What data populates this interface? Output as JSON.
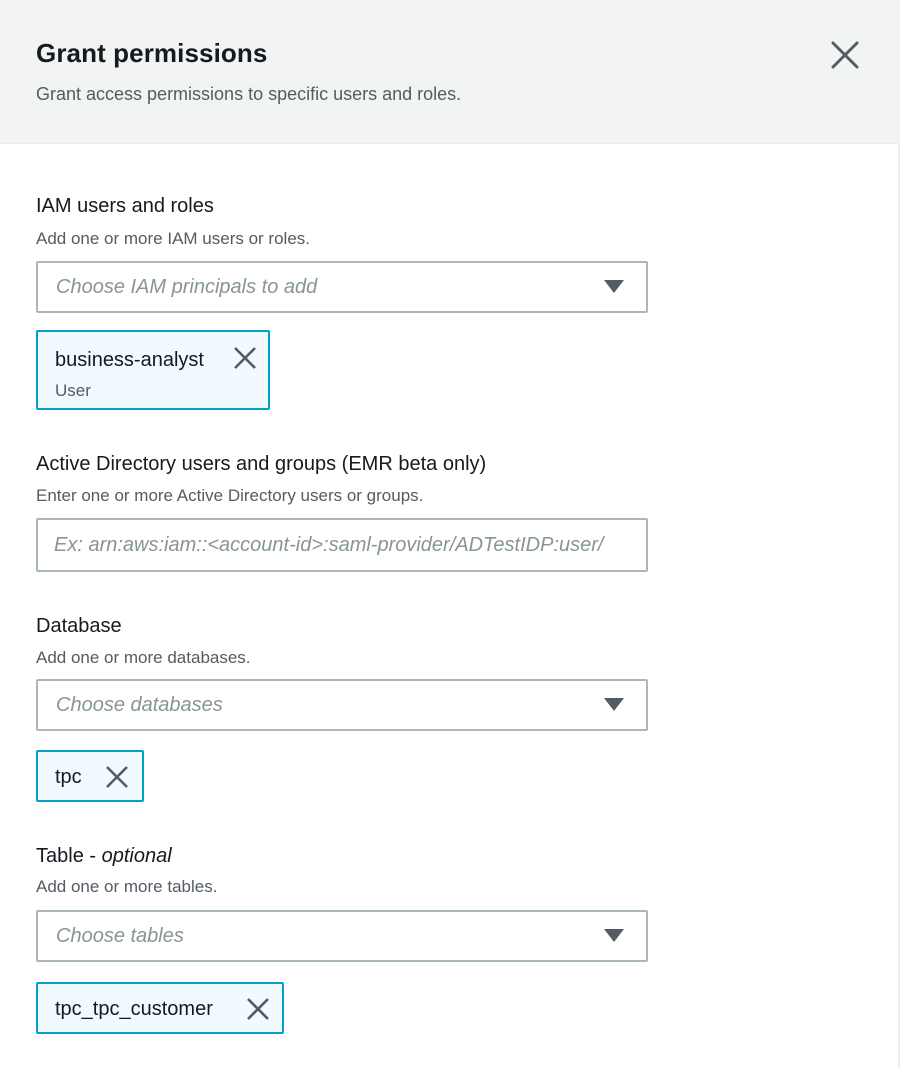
{
  "modal": {
    "title": "Grant permissions",
    "subtitle": "Grant access permissions to specific users and roles.",
    "close_icon": "close-icon"
  },
  "iam": {
    "label": "IAM users and roles",
    "description": "Add one or more IAM users or roles.",
    "placeholder": "Choose IAM principals to add",
    "tokens": [
      {
        "name": "business-analyst",
        "type": "User"
      }
    ]
  },
  "active_directory": {
    "label": "Active Directory users and groups (EMR beta only)",
    "description": "Enter one or more Active Directory users or groups.",
    "placeholder": "Ex: arn:aws:iam::<account-id>:saml-provider/ADTestIDP:user/",
    "value": ""
  },
  "database": {
    "label": "Database",
    "description": "Add one or more databases.",
    "placeholder": "Choose databases",
    "tokens": [
      {
        "name": "tpc"
      }
    ]
  },
  "table": {
    "label": "Table - ",
    "label_optional": "optional",
    "description": "Add one or more tables.",
    "placeholder": "Choose tables",
    "tokens": [
      {
        "name": "tpc_tpc_customer"
      }
    ]
  },
  "colors": {
    "header_bg": "#f2f3f3",
    "token_border": "#00a1c9",
    "token_bg": "#f1faff",
    "input_border": "#aab7b8",
    "placeholder": "#879596",
    "text_primary": "#16191f",
    "text_secondary": "#545b64"
  }
}
